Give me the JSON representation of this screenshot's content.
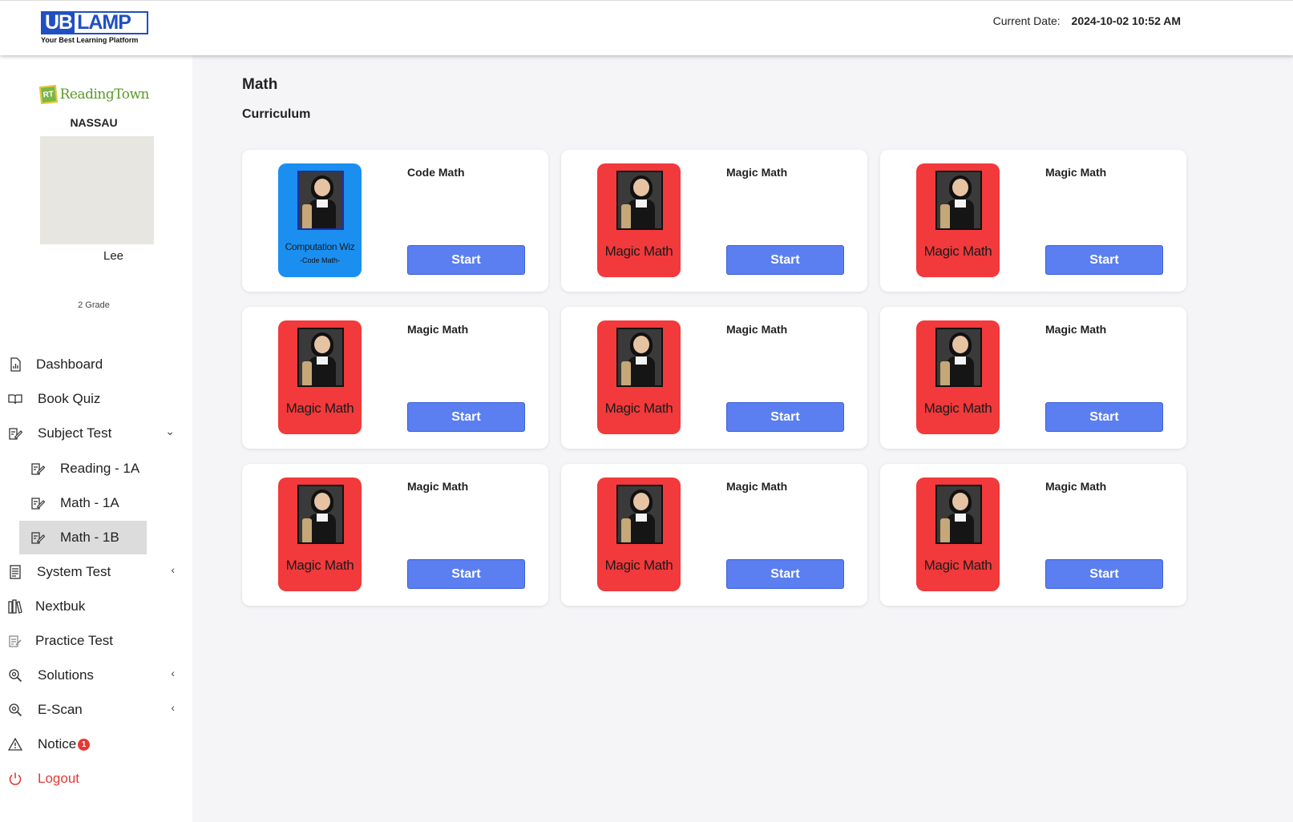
{
  "header": {
    "logo": {
      "ub": "UB",
      "lamp": "LAMP",
      "tagline": "Your Best Learning Platform"
    },
    "date_label": "Current Date:",
    "date_value": "2024-10-02 10:52 AM"
  },
  "sidebar": {
    "brand_badge": "RT",
    "brand_text": "ReadingTown",
    "school": "NASSAU",
    "user_name": "Lee",
    "grade": "2 Grade",
    "items": {
      "dashboard": "Dashboard",
      "book_quiz": "Book Quiz",
      "subject_test": "Subject Test",
      "reading_1a": "Reading - 1A",
      "math_1a": "Math - 1A",
      "math_1b": "Math - 1B",
      "system_test": "System Test",
      "nextbuk": "Nextbuk",
      "practice_test": "Practice Test",
      "solutions": "Solutions",
      "escan": "E-Scan",
      "notice": "Notice",
      "notice_count": "1",
      "logout": "Logout"
    }
  },
  "main": {
    "title": "Math",
    "section": "Curriculum",
    "cards": [
      {
        "name": "Code Math",
        "cover_title": "Computation Wiz",
        "cover_sub": "-Code Math-",
        "cover_color": "#1b8ff0",
        "button": "Start"
      },
      {
        "name": "Magic Math",
        "cover_title": "Magic Math",
        "cover_color": "#f2393b",
        "button": "Start"
      },
      {
        "name": "Magic Math",
        "cover_title": "Magic Math",
        "cover_color": "#f2393b",
        "button": "Start"
      },
      {
        "name": "Magic Math",
        "cover_title": "Magic Math",
        "cover_color": "#f2393b",
        "button": "Start"
      },
      {
        "name": "Magic Math",
        "cover_title": "Magic Math",
        "cover_color": "#f2393b",
        "button": "Start"
      },
      {
        "name": "Magic Math",
        "cover_title": "Magic Math",
        "cover_color": "#f2393b",
        "button": "Start"
      },
      {
        "name": "Magic Math",
        "cover_title": "Magic Math",
        "cover_color": "#f2393b",
        "button": "Start"
      },
      {
        "name": "Magic Math",
        "cover_title": "Magic Math",
        "cover_color": "#f2393b",
        "button": "Start"
      },
      {
        "name": "Magic Math",
        "cover_title": "Magic Math",
        "cover_color": "#f2393b",
        "button": "Start"
      }
    ]
  }
}
